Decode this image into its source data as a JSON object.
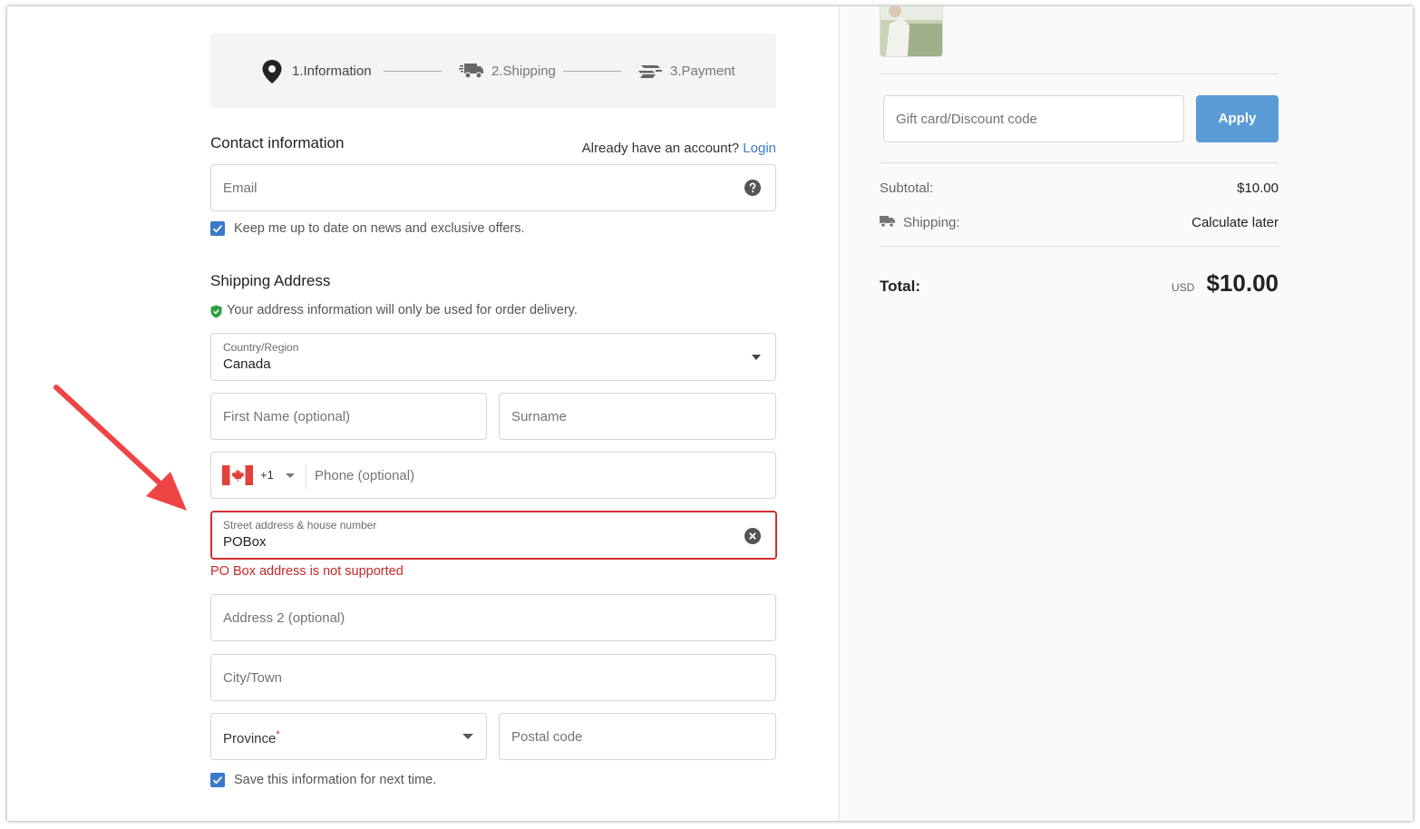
{
  "steps": {
    "step1": "1.Information",
    "step2": "2.Shipping",
    "step3": "3.Payment"
  },
  "contact": {
    "title": "Contact information",
    "account_prompt": "Already have an account?",
    "login_link": "Login",
    "email_placeholder": "Email",
    "newsletter_label": "Keep me up to date on news and exclusive offers.",
    "newsletter_checked": true
  },
  "shipping": {
    "title": "Shipping Address",
    "privacy_note": "Your address information will only be used for order delivery.",
    "country_label": "Country/Region",
    "country_value": "Canada",
    "first_name_placeholder": "First Name (optional)",
    "surname_placeholder": "Surname",
    "phone_code": "+1",
    "phone_placeholder": "Phone (optional)",
    "street_label": "Street address & house number",
    "street_value": "POBox",
    "street_error": "PO Box address is not supported",
    "address2_placeholder": "Address 2 (optional)",
    "city_placeholder": "City/Town",
    "province_label": "Province",
    "province_required_mark": "*",
    "postal_placeholder": "Postal code",
    "save_info_label": "Save this information for next time.",
    "save_info_checked": true
  },
  "summary": {
    "discount_placeholder": "Gift card/Discount code",
    "apply_label": "Apply",
    "subtotal_label": "Subtotal:",
    "subtotal_value": "$10.00",
    "shipping_label": "Shipping:",
    "shipping_value": "Calculate later",
    "total_label": "Total:",
    "currency": "USD",
    "total_value": "$10.00"
  },
  "colors": {
    "accent": "#3b7ac9",
    "apply_button": "#5b9bd5",
    "error": "#d32f2f",
    "annotation_arrow": "#ee4444",
    "secure_icon": "#2ea043"
  },
  "icons": [
    "location-pin-icon",
    "delivery-truck-icon",
    "payment-hand-icon",
    "help-circle-icon",
    "shield-check-icon",
    "chevron-down-icon",
    "canada-flag-icon",
    "clear-circle-icon",
    "truck-small-icon"
  ]
}
